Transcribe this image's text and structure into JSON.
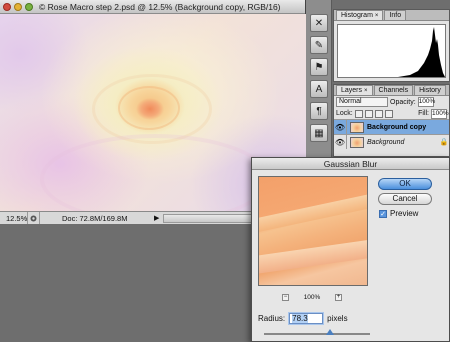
{
  "document": {
    "title": "© Rose Macro step 2.psd @ 12.5% (Background copy, RGB/16)",
    "zoom": "12.5%",
    "status": "Doc: 72.8M/169.8M"
  },
  "histogram_panel": {
    "tabs": [
      {
        "label": "Histogram"
      },
      {
        "label": "Info"
      }
    ]
  },
  "layers_panel": {
    "tabs": [
      {
        "label": "Layers"
      },
      {
        "label": "Channels"
      },
      {
        "label": "History"
      }
    ],
    "blend_mode": "Normal",
    "opacity_label": "Opacity:",
    "opacity_value": "100%",
    "lock_label": "Lock:",
    "fill_label": "Fill:",
    "fill_value": "100%",
    "layers": [
      {
        "name": "Background copy",
        "selected": true
      },
      {
        "name": "Background",
        "selected": false
      }
    ]
  },
  "dialog": {
    "title": "Gaussian Blur",
    "ok_label": "OK",
    "cancel_label": "Cancel",
    "preview_label": "Preview",
    "preview_checked": true,
    "zoom_value": "100%",
    "radius_label": "Radius:",
    "radius_value": "78.3",
    "radius_unit": "pixels",
    "slider_fraction": 0.62
  },
  "icons": {
    "eye": "eye-icon",
    "lock": "lock-icon",
    "zoom_out": "zoom-out-icon",
    "zoom_in": "zoom-in-icon"
  },
  "colors": {
    "selected_layer": "#7aa9de",
    "ok_button": "#4b8fdc"
  }
}
